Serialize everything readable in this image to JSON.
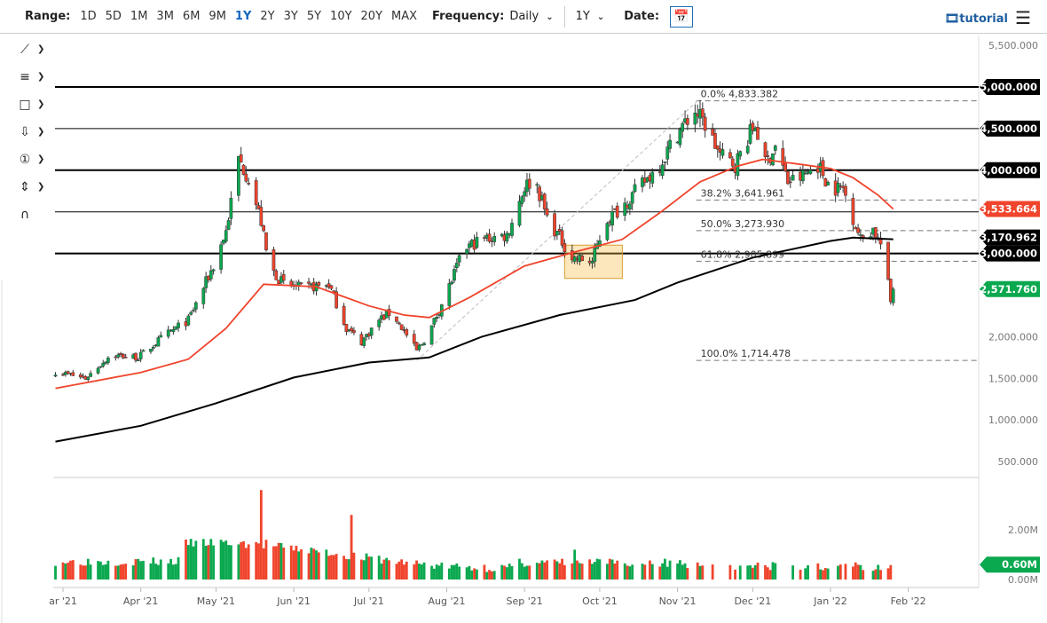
{
  "toolbar": {
    "range_label": "Range:",
    "ranges": [
      "1D",
      "5D",
      "1M",
      "3M",
      "6M",
      "9M",
      "1Y",
      "2Y",
      "3Y",
      "5Y",
      "10Y",
      "20Y",
      "MAX"
    ],
    "active_range": "1Y",
    "frequency_label": "Frequency:",
    "frequency_value": "Daily",
    "period_value": "1Y",
    "date_label": "Date:",
    "tutorial_label": "tutorial"
  },
  "drawing_tools": [
    {
      "name": "trend-line-icon",
      "glyph": "⟋"
    },
    {
      "name": "fib-retracement-icon",
      "glyph": "≡"
    },
    {
      "name": "rectangle-icon",
      "glyph": "□"
    },
    {
      "name": "arrow-down-icon",
      "glyph": "⇩"
    },
    {
      "name": "annotation-number-icon",
      "glyph": "①"
    },
    {
      "name": "measure-icon",
      "glyph": "⇕"
    },
    {
      "name": "magnet-icon",
      "glyph": "∩"
    }
  ],
  "colors": {
    "up": "#0aa84f",
    "down": "#f0442c",
    "ma_fast": "#f0442c",
    "ma_slow": "#000000",
    "box": "#f7ba3e"
  },
  "chart_data": {
    "type": "candlestick",
    "start_date": "2021-02-26",
    "end_date": "2022-01-26",
    "y_axis": {
      "min": 500,
      "max": 5500,
      "ticks": [
        "5,500.000",
        "2,000.000",
        "1,500.000",
        "1,000.000",
        "500.000"
      ],
      "tick_values": [
        5500,
        2000,
        1500,
        1000,
        500
      ]
    },
    "x_axis": {
      "ticks": [
        {
          "label": "ar '21",
          "date": "2021-03-01"
        },
        {
          "label": "Apr '21",
          "date": "2021-04-01"
        },
        {
          "label": "May '21",
          "date": "2021-05-01"
        },
        {
          "label": "Jun '21",
          "date": "2021-06-01"
        },
        {
          "label": "Jul '21",
          "date": "2021-07-01"
        },
        {
          "label": "Aug '21",
          "date": "2021-08-01"
        },
        {
          "label": "Sep '21",
          "date": "2021-09-01"
        },
        {
          "label": "Oct '21",
          "date": "2021-10-01"
        },
        {
          "label": "Nov '21",
          "date": "2021-11-01"
        },
        {
          "label": "Dec '21",
          "date": "2021-12-01"
        },
        {
          "label": "Jan '22",
          "date": "2022-01-01"
        },
        {
          "label": "Feb '22",
          "date": "2022-02-01"
        }
      ]
    },
    "close_path": [
      [
        "2021-02-26",
        1580
      ],
      [
        "2021-03-10",
        1500
      ],
      [
        "2021-03-20",
        1780
      ],
      [
        "2021-03-31",
        1750
      ],
      [
        "2021-04-10",
        2000
      ],
      [
        "2021-04-20",
        2200
      ],
      [
        "2021-04-30",
        2850
      ],
      [
        "2021-05-05",
        3270
      ],
      [
        "2021-05-10",
        4130
      ],
      [
        "2021-05-14",
        3910
      ],
      [
        "2021-05-19",
        3380
      ],
      [
        "2021-05-22",
        2850
      ],
      [
        "2021-05-28",
        2630
      ],
      [
        "2021-06-05",
        2580
      ],
      [
        "2021-06-15",
        2630
      ],
      [
        "2021-06-22",
        2100
      ],
      [
        "2021-06-28",
        1940
      ],
      [
        "2021-07-05",
        2200
      ],
      [
        "2021-07-10",
        2300
      ],
      [
        "2021-07-20",
        1830
      ],
      [
        "2021-07-25",
        2050
      ],
      [
        "2021-08-01",
        2530
      ],
      [
        "2021-08-08",
        3060
      ],
      [
        "2021-08-15",
        3170
      ],
      [
        "2021-08-25",
        3220
      ],
      [
        "2021-09-01",
        3800
      ],
      [
        "2021-09-05",
        3910
      ],
      [
        "2021-09-10",
        3430
      ],
      [
        "2021-09-20",
        2950
      ],
      [
        "2021-09-28",
        2900
      ],
      [
        "2021-10-03",
        3380
      ],
      [
        "2021-10-10",
        3570
      ],
      [
        "2021-10-17",
        3800
      ],
      [
        "2021-10-25",
        4070
      ],
      [
        "2021-11-01",
        4450
      ],
      [
        "2021-11-08",
        4710
      ],
      [
        "2021-11-12",
        4550
      ],
      [
        "2021-11-18",
        4180
      ],
      [
        "2021-11-24",
        4070
      ],
      [
        "2021-11-29",
        4390
      ],
      [
        "2021-12-02",
        4550
      ],
      [
        "2021-12-06",
        4070
      ],
      [
        "2021-12-10",
        4290
      ],
      [
        "2021-12-15",
        3860
      ],
      [
        "2021-12-20",
        3910
      ],
      [
        "2021-12-27",
        4070
      ],
      [
        "2022-01-01",
        3785
      ],
      [
        "2022-01-06",
        3785
      ],
      [
        "2022-01-10",
        3430
      ],
      [
        "2022-01-13",
        3170
      ],
      [
        "2022-01-18",
        3295
      ],
      [
        "2022-01-21",
        3110
      ],
      [
        "2022-01-24",
        2630
      ],
      [
        "2022-01-25",
        2420
      ],
      [
        "2022-01-26",
        2572
      ]
    ],
    "series": [
      {
        "name": "MA fast",
        "color": "#f0442c",
        "last_value": "3,533.664",
        "points": [
          [
            "2021-02-26",
            1380
          ],
          [
            "2021-04-01",
            1570
          ],
          [
            "2021-04-20",
            1730
          ],
          [
            "2021-05-05",
            2100
          ],
          [
            "2021-05-20",
            2630
          ],
          [
            "2021-06-10",
            2600
          ],
          [
            "2021-07-01",
            2370
          ],
          [
            "2021-07-15",
            2260
          ],
          [
            "2021-07-25",
            2230
          ],
          [
            "2021-08-10",
            2470
          ],
          [
            "2021-09-01",
            2850
          ],
          [
            "2021-09-20",
            3010
          ],
          [
            "2021-10-10",
            3170
          ],
          [
            "2021-10-25",
            3490
          ],
          [
            "2021-11-10",
            3860
          ],
          [
            "2021-11-25",
            4050
          ],
          [
            "2021-12-05",
            4130
          ],
          [
            "2021-12-20",
            4070
          ],
          [
            "2022-01-01",
            4020
          ],
          [
            "2022-01-10",
            3910
          ],
          [
            "2022-01-20",
            3700
          ],
          [
            "2022-01-26",
            3533.664
          ]
        ]
      },
      {
        "name": "MA slow",
        "color": "#000000",
        "last_value": "3,170.962",
        "points": [
          [
            "2021-02-26",
            740
          ],
          [
            "2021-04-01",
            930
          ],
          [
            "2021-05-01",
            1200
          ],
          [
            "2021-06-01",
            1510
          ],
          [
            "2021-07-01",
            1690
          ],
          [
            "2021-07-25",
            1750
          ],
          [
            "2021-08-15",
            2000
          ],
          [
            "2021-09-15",
            2260
          ],
          [
            "2021-10-15",
            2440
          ],
          [
            "2021-11-01",
            2650
          ],
          [
            "2021-12-01",
            2950
          ],
          [
            "2022-01-01",
            3150
          ],
          [
            "2022-01-10",
            3190
          ],
          [
            "2022-01-26",
            3170.962
          ]
        ]
      }
    ],
    "last_price": "2,571.760",
    "horizontal_levels": [
      {
        "value": 5000,
        "label": "5,000.000",
        "weight": "bold"
      },
      {
        "value": 4500,
        "label": "4,500.000",
        "weight": "thin"
      },
      {
        "value": 4000,
        "label": "4,000.000",
        "weight": "bold"
      },
      {
        "value": 3500,
        "label": "",
        "weight": "thin"
      },
      {
        "value": 3000,
        "label": "3,000.000",
        "weight": "bold"
      }
    ],
    "fibonacci": [
      {
        "label": "0.0% 4,833.382",
        "value": 4833.382
      },
      {
        "label": "38.2% 3,641.961",
        "value": 3641.961
      },
      {
        "label": "50.0% 3,273.930",
        "value": 3273.93
      },
      {
        "label": "61.8% 2,905.899",
        "value": 2905.899
      },
      {
        "label": "100.0% 1,714.478",
        "value": 1714.478
      }
    ],
    "fib_anchor": {
      "from": [
        "2021-07-20",
        1714.478
      ],
      "to": [
        "2021-11-09",
        4833.382
      ],
      "start": "2021-11-12"
    },
    "highlight_box": {
      "from": [
        "2021-09-17",
        3100
      ],
      "to": [
        "2021-10-10",
        2700
      ]
    },
    "volume": {
      "ticks": [
        "2.00M",
        "0.00M"
      ],
      "tick_values": [
        2,
        0
      ],
      "last_value": "0.60M",
      "max": 3.1,
      "spikes": [
        [
          "2021-05-19",
          3.6
        ],
        [
          "2021-06-24",
          2.6
        ],
        [
          "2021-05-17",
          1.5
        ],
        [
          "2021-05-21",
          1.6
        ],
        [
          "2021-09-21",
          1.2
        ]
      ]
    }
  }
}
